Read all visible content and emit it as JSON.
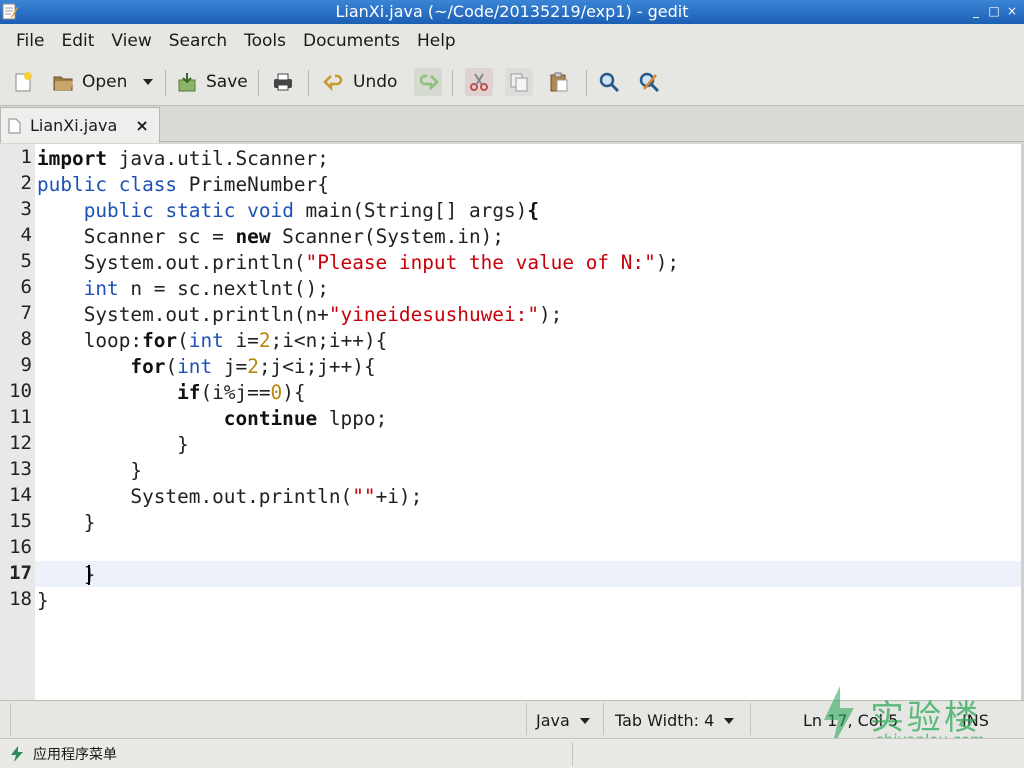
{
  "window": {
    "title": "LianXi.java (~/Code/20135219/exp1) - gedit",
    "controls": [
      "_",
      "□",
      "×"
    ]
  },
  "menu": [
    "File",
    "Edit",
    "View",
    "Search",
    "Tools",
    "Documents",
    "Help"
  ],
  "toolbar": {
    "open_label": "Open",
    "save_label": "Save",
    "undo_label": "Undo"
  },
  "tabs": [
    {
      "label": "LianXi.java"
    }
  ],
  "editor": {
    "current_line": 17,
    "lines": [
      {
        "n": "1",
        "t": [
          [
            "kw",
            "import"
          ],
          [
            "",
            " java.util.Scanner;"
          ]
        ]
      },
      {
        "n": "2",
        "t": [
          [
            "ty",
            "public"
          ],
          [
            "",
            " "
          ],
          [
            "ty",
            "class"
          ],
          [
            "",
            " PrimeNumber{"
          ]
        ]
      },
      {
        "n": "3",
        "t": [
          [
            "",
            "    "
          ],
          [
            "ty",
            "public"
          ],
          [
            "",
            " "
          ],
          [
            "ty",
            "static"
          ],
          [
            "",
            " "
          ],
          [
            "ty",
            "void"
          ],
          [
            "",
            " main(String[] args)"
          ],
          [
            "kw",
            "{"
          ]
        ]
      },
      {
        "n": "4",
        "t": [
          [
            "",
            "    Scanner sc = "
          ],
          [
            "kw",
            "new"
          ],
          [
            "",
            " Scanner(System.in);"
          ]
        ]
      },
      {
        "n": "5",
        "t": [
          [
            "",
            "    System.out.println("
          ],
          [
            "st",
            "\"Please input the value of N:\""
          ],
          [
            "",
            ");"
          ]
        ]
      },
      {
        "n": "6",
        "t": [
          [
            "",
            "    "
          ],
          [
            "ty",
            "int"
          ],
          [
            "",
            " n = sc.nextlnt();"
          ]
        ]
      },
      {
        "n": "7",
        "t": [
          [
            "",
            "    System.out.println(n+"
          ],
          [
            "st",
            "\"yineidesushuwei:\""
          ],
          [
            "",
            ");"
          ]
        ]
      },
      {
        "n": "8",
        "t": [
          [
            "",
            "    loop:"
          ],
          [
            "kw",
            "for"
          ],
          [
            "",
            "("
          ],
          [
            "ty",
            "int"
          ],
          [
            "",
            " i="
          ],
          [
            "nm",
            "2"
          ],
          [
            "",
            ";i<n;i++){"
          ]
        ]
      },
      {
        "n": "9",
        "t": [
          [
            "",
            "        "
          ],
          [
            "kw",
            "for"
          ],
          [
            "",
            "("
          ],
          [
            "ty",
            "int"
          ],
          [
            "",
            " j="
          ],
          [
            "nm",
            "2"
          ],
          [
            "",
            ";j<i;j++){"
          ]
        ]
      },
      {
        "n": "10",
        "t": [
          [
            "",
            "            "
          ],
          [
            "kw",
            "if"
          ],
          [
            "",
            "(i%j=="
          ],
          [
            "nm",
            "0"
          ],
          [
            "",
            "){"
          ]
        ]
      },
      {
        "n": "11",
        "t": [
          [
            "",
            "                "
          ],
          [
            "kw",
            "continue"
          ],
          [
            "",
            " lppo;"
          ]
        ]
      },
      {
        "n": "12",
        "t": [
          [
            "",
            "            }"
          ]
        ]
      },
      {
        "n": "13",
        "t": [
          [
            "",
            "        }"
          ]
        ]
      },
      {
        "n": "14",
        "t": [
          [
            "",
            "        System.out.println("
          ],
          [
            "st",
            "\"\""
          ],
          [
            "",
            "+i);"
          ]
        ]
      },
      {
        "n": "15",
        "t": [
          [
            "",
            "    }"
          ]
        ]
      },
      {
        "n": "16",
        "t": [
          [
            "",
            ""
          ]
        ]
      },
      {
        "n": "17",
        "t": [
          [
            "",
            "    }"
          ]
        ]
      },
      {
        "n": "18",
        "t": [
          [
            "",
            "}"
          ]
        ]
      }
    ]
  },
  "statusbar": {
    "language": "Java",
    "tab_width": "Tab Width: 4",
    "position": "Ln 17, Col 5",
    "mode": "INS"
  },
  "watermark": {
    "text": "实验楼",
    "sub": "shiyanlou.com"
  },
  "taskbar": {
    "start_label": "应用程序菜单"
  },
  "colors": {
    "keyword_type": "#1c52b5",
    "string": "#c7000a",
    "number": "#b8860b",
    "title_bar": "#1c5fb4",
    "current_line": "#edf2fa"
  }
}
